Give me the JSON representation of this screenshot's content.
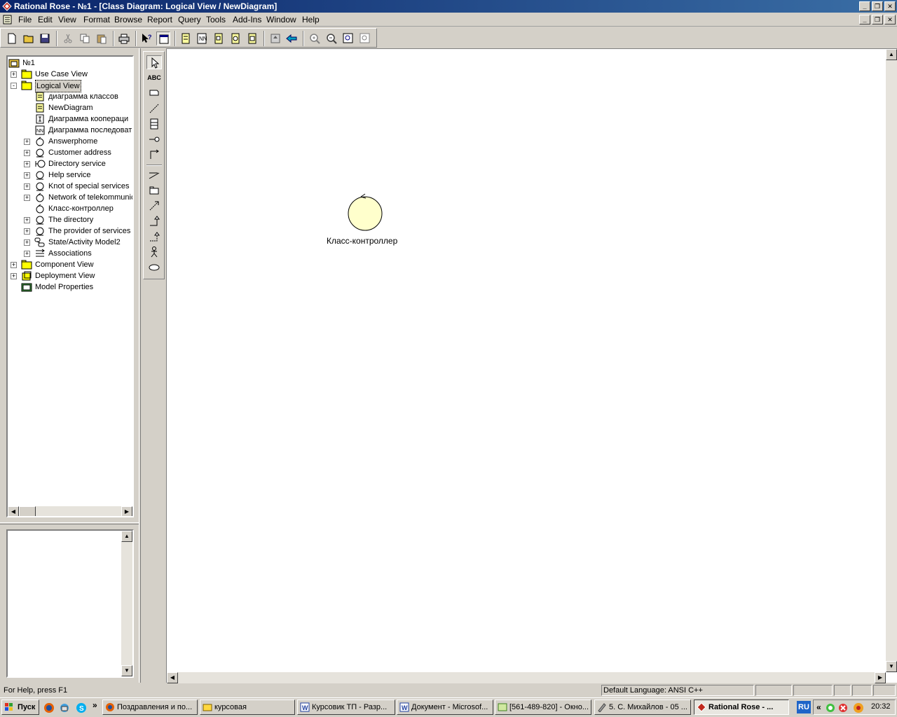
{
  "window": {
    "title": "Rational Rose - №1 - [Class Diagram: Logical View / NewDiagram]",
    "caption_buttons": [
      "_",
      "❐",
      "✕"
    ]
  },
  "menu": [
    "File",
    "Edit",
    "View",
    "Format",
    "Browse",
    "Report",
    "Query",
    "Tools",
    "Add-Ins",
    "Window",
    "Help"
  ],
  "toolbar": {
    "icons": [
      "new-icon",
      "open-icon",
      "save-icon",
      "cut-icon",
      "copy-icon",
      "paste-icon",
      "print-icon",
      "context-help-icon",
      "view-doc-icon",
      "class-diagram-icon",
      "interaction-diagram-icon",
      "component-diagram-icon",
      "deployment-diagram-icon",
      "state-diagram-icon",
      "browse-parent-icon",
      "previous-diagram-icon",
      "zoom-in-icon",
      "zoom-out-icon",
      "fit-in-window-icon",
      "undo-fit-icon"
    ]
  },
  "tree": {
    "root": "№1",
    "items": [
      {
        "label": "Use Case View",
        "level": 1,
        "icon": "folder-icon",
        "expander": "+"
      },
      {
        "label": "Logical View",
        "level": 1,
        "icon": "folder-open-icon",
        "expander": "-",
        "selected": true
      },
      {
        "label": "диаграмма классов",
        "level": 2,
        "icon": "class-diagram-icon",
        "expander": ""
      },
      {
        "label": "NewDiagram",
        "level": 2,
        "icon": "class-diagram-icon",
        "expander": ""
      },
      {
        "label": "Диаграмма коопераци",
        "level": 2,
        "icon": "collaboration-diagram-icon",
        "expander": ""
      },
      {
        "label": "Диаграмма последоват",
        "level": 2,
        "icon": "sequence-diagram-icon",
        "expander": ""
      },
      {
        "label": "Answerphome",
        "level": 2,
        "icon": "control-class-icon",
        "expander": "+"
      },
      {
        "label": "Customer address",
        "level": 2,
        "icon": "entity-class-icon",
        "expander": "+"
      },
      {
        "label": "Directory service",
        "level": 2,
        "icon": "boundary-class-icon",
        "expander": "+"
      },
      {
        "label": "Help service",
        "level": 2,
        "icon": "entity-class-icon",
        "expander": "+"
      },
      {
        "label": "Knot of special services",
        "level": 2,
        "icon": "entity-class-icon",
        "expander": "+"
      },
      {
        "label": "Network of telekommunic",
        "level": 2,
        "icon": "control-class-icon",
        "expander": "+"
      },
      {
        "label": "Класс-контроллер",
        "level": 2,
        "icon": "control-class-icon",
        "expander": ""
      },
      {
        "label": "The directory",
        "level": 2,
        "icon": "entity-class-icon",
        "expander": "+"
      },
      {
        "label": "The provider of services c",
        "level": 2,
        "icon": "entity-class-icon",
        "expander": "+"
      },
      {
        "label": "State/Activity Model2",
        "level": 2,
        "icon": "state-model-icon",
        "expander": "+"
      },
      {
        "label": "Associations",
        "level": 2,
        "icon": "associations-icon",
        "expander": "+"
      },
      {
        "label": "Component View",
        "level": 1,
        "icon": "folder-icon",
        "expander": "+"
      },
      {
        "label": "Deployment View",
        "level": 1,
        "icon": "deployment-icon",
        "expander": "+"
      },
      {
        "label": "Model Properties",
        "level": 1,
        "icon": "model-properties-icon",
        "expander": ""
      }
    ]
  },
  "toolbox": {
    "tools": [
      "selection-tool-icon",
      "text-box-tool-icon",
      "note-tool-icon",
      "anchor-note-tool-icon",
      "class-tool-icon",
      "interface-tool-icon",
      "association-tool-icon",
      "aggregation-tool-icon",
      "package-tool-icon",
      "dependency-tool-icon",
      "generalization-tool-icon",
      "realize-tool-icon",
      "actor-tool-icon",
      "use-case-tool-icon"
    ],
    "text_tool_label": "ABC"
  },
  "diagram": {
    "element_label": "Класс-контроллер",
    "element_fill": "#ffffcc"
  },
  "statusbar": {
    "help": "For Help, press F1",
    "language": "Default Language: ANSI C++"
  },
  "taskbar": {
    "start": "Пуск",
    "tasks": [
      {
        "label": "Поздравления и по...",
        "icon": "firefox-icon"
      },
      {
        "label": "курсовая",
        "icon": "folder-icon"
      },
      {
        "label": "Курсовик ТП - Разр...",
        "icon": "word-icon"
      },
      {
        "label": "Документ - Microsof...",
        "icon": "word-icon"
      },
      {
        "label": "[561-489-820] - Окно...",
        "icon": "icq-icon"
      },
      {
        "label": "5. С. Михайлов - 05 ...",
        "icon": "media-player-icon"
      },
      {
        "label": "Rational Rose - ...",
        "icon": "rational-rose-icon",
        "active": true
      }
    ],
    "lang": "RU",
    "time": "20:32",
    "quicklaunch_more": "»",
    "tray_more": "«"
  },
  "colors": {
    "title_start": "#0a246a",
    "title_end": "#3a6ea5",
    "chrome": "#d4d0c8",
    "selection": "#d4d0c8",
    "lang_badge": "#1e64c8"
  }
}
